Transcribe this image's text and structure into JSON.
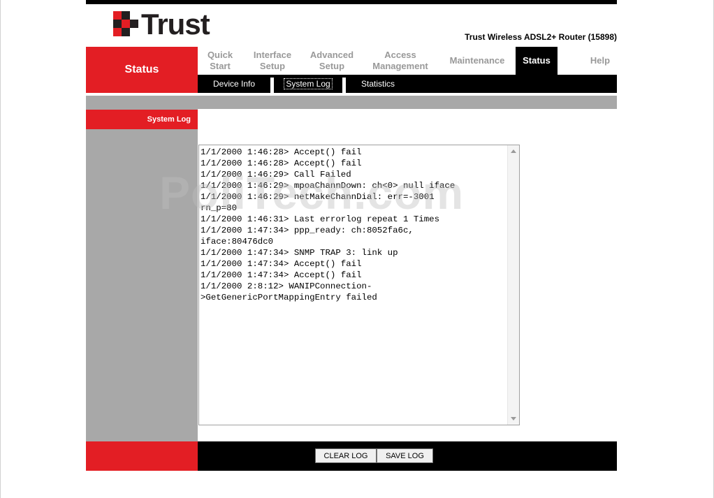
{
  "brand": {
    "logo_text": "Trust",
    "product": "Trust Wireless ADSL2+ Router (15898)"
  },
  "left_title": "Status",
  "nav": [
    {
      "label": "Quick\nStart"
    },
    {
      "label": "Interface\nSetup"
    },
    {
      "label": "Advanced\nSetup"
    },
    {
      "label": "Access\nManagement"
    },
    {
      "label": "Maintenance"
    },
    {
      "label": "Status",
      "active": true
    },
    {
      "label": "Help"
    }
  ],
  "subnav": [
    {
      "label": "Device Info"
    },
    {
      "label": "System Log",
      "active": true
    },
    {
      "label": "Statistics"
    }
  ],
  "section_label": "System Log",
  "log": "1/1/2000 1:46:28> Accept() fail\n1/1/2000 1:46:28> Accept() fail\n1/1/2000 1:46:29> Call Failed\n1/1/2000 1:46:29> mpoaChannDown: ch<0> null iface\n1/1/2000 1:46:29> netMakeChannDial: err=-3001\nrn_p=80\n1/1/2000 1:46:31> Last errorlog repeat 1 Times\n1/1/2000 1:47:34> ppp_ready: ch:8052fa6c,\niface:80476dc0\n1/1/2000 1:47:34> SNMP TRAP 3: link up\n1/1/2000 1:47:34> Accept() fail\n1/1/2000 1:47:34> Accept() fail\n1/1/2000 2:8:12> WANIPConnection-\n>GetGenericPortMappingEntry failed",
  "buttons": {
    "clear": "CLEAR LOG",
    "save": "SAVE LOG"
  },
  "watermark": "PoliTech.com",
  "colors": {
    "brand_red": "#e31e24",
    "nav_black": "#000000",
    "side_gray": "#a8a8a8"
  },
  "icons": {
    "scroll_up": "arrow-up-icon",
    "scroll_down": "arrow-down-icon",
    "logo": "trust-logo-icon"
  }
}
